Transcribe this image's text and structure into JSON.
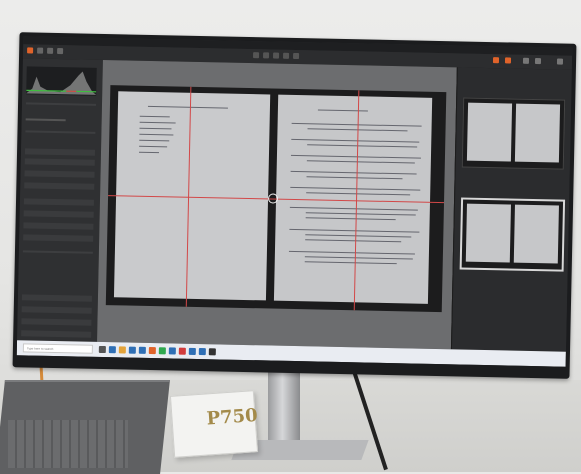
{
  "screen": {
    "app_title": "",
    "taskbar": {
      "search_placeholder": "Type here to search",
      "clock": ""
    },
    "viewer": {
      "caption": ""
    },
    "thumbnails": [
      {
        "caption": ""
      },
      {
        "caption": ""
      }
    ]
  },
  "ssd": {
    "brand": "",
    "model": "P750"
  },
  "colors": {
    "guide_red": "#d24848",
    "accent_orange": "#e0632a",
    "cable_orange": "#d58a3a"
  }
}
